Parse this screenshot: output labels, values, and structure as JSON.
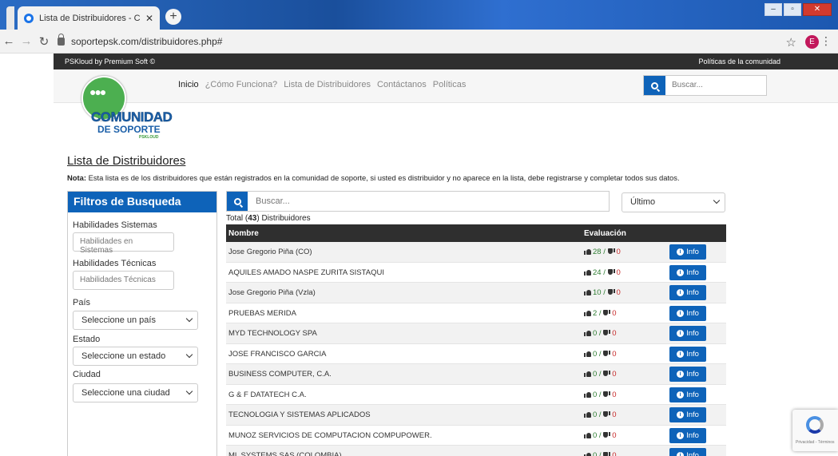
{
  "browser": {
    "tab_title": "Lista de Distribuidores - Comunic",
    "url": "soportepsk.com/distribuidores.php#",
    "profile_initial": "E"
  },
  "topstrip": {
    "brand": "PSKloud by Premium Soft ©",
    "policies": "Políticas de la comunidad"
  },
  "nav": {
    "items": [
      "Inicio",
      "¿Cómo Funciona?",
      "Lista de Distribuidores",
      "Contáctanos",
      "Políticas"
    ],
    "search_placeholder": "Buscar..."
  },
  "logo": {
    "line1": "COMUNIDAD",
    "line2": "DE SOPORTE",
    "line3": "PSKLOUD"
  },
  "page": {
    "title": "Lista de Distribuidores",
    "note_label": "Nota:",
    "note_text": " Esta lista es de los distribuidores que están registrados en la comunidad de soporte, si usted es distribuidor y no aparece en la lista, debe registrarse y completar todos sus datos."
  },
  "filters": {
    "title": "Filtros de Busqueda",
    "sistemas_label": "Habilidades Sistemas",
    "sistemas_placeholder": "Habilidades en Sistemas",
    "tecnicas_label": "Habilidades Técnicas",
    "tecnicas_placeholder": "Habilidades Técnicas",
    "pais_label": "País",
    "pais_value": "Seleccione un país",
    "estado_label": "Estado",
    "estado_value": "Seleccione un estado",
    "ciudad_label": "Ciudad",
    "ciudad_value": "Seleccione una ciudad"
  },
  "results": {
    "search_placeholder": "Buscar...",
    "sort_value": "Último",
    "total_prefix": "Total (",
    "total_count": "43",
    "total_suffix": ") Distribuidores",
    "col_name": "Nombre",
    "col_eval": "Evaluación",
    "info_label": "Info",
    "rows": [
      {
        "name": "Jose Gregorio Piña (CO)",
        "up": "28",
        "down": "0"
      },
      {
        "name": "AQUILES AMADO NASPE ZURITA SISTAQUI",
        "up": "24",
        "down": "0"
      },
      {
        "name": "Jose Gregorio Piña (Vzla)",
        "up": "10",
        "down": "0"
      },
      {
        "name": "PRUEBAS MERIDA",
        "up": "2",
        "down": "0"
      },
      {
        "name": "MYD TECHNOLOGY SPA",
        "up": "0",
        "down": "0"
      },
      {
        "name": "JOSE FRANCISCO GARCIA",
        "up": "0",
        "down": "0"
      },
      {
        "name": "BUSINESS COMPUTER, C.A.",
        "up": "0",
        "down": "0"
      },
      {
        "name": "G & F DATATECH C.A.",
        "up": "0",
        "down": "0"
      },
      {
        "name": "TECNOLOGIA Y SISTEMAS APLICADOS",
        "up": "0",
        "down": "0"
      },
      {
        "name": "MUNOZ SERVICIOS DE COMPUTACION COMPUPOWER.",
        "up": "0",
        "down": "0"
      },
      {
        "name": "ML SYSTEMS SAS (COLOMBIA)",
        "up": "0",
        "down": "0"
      }
    ]
  },
  "recaptcha": {
    "text": "Privacidad - Términos"
  },
  "colors": {
    "primary": "#0e63b9",
    "dark": "#2f2f2f",
    "positive": "#2e7d32",
    "negative": "#c62828"
  }
}
